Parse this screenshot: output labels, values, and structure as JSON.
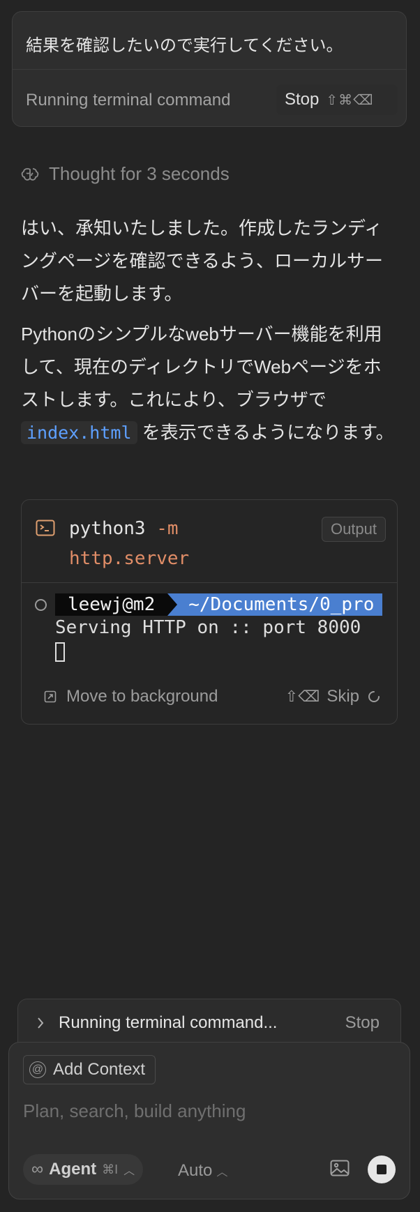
{
  "user_message": {
    "text": "結果を確認したいので実行してください。",
    "status": "Running terminal command",
    "stop_label": "Stop",
    "stop_shortcut": "⇧⌘⌫"
  },
  "thought": {
    "icon": "brain-icon",
    "label": "Thought for 3 seconds"
  },
  "assistant": {
    "p1": "はい、承知いたしました。作成したランディングページを確認できるよう、ローカルサーバーを起動します。",
    "p2_before": "Pythonのシンプルなwebサーバー機能を利用して、現在のディレクトリでWebページをホストします。これにより、ブラウザで",
    "p2_code": "index.html",
    "p2_after": "を表示できるようになります。"
  },
  "terminal": {
    "icon": "terminal-icon",
    "cmd_main": "python3",
    "cmd_flag": "-m",
    "cmd_arg": "http.server",
    "output_label": "Output",
    "prompt_user": "leewj@m2",
    "prompt_path": "~/Documents/0_pro",
    "output_line": "Serving HTTP on :: port 8000",
    "move_bg_label": "Move to background",
    "skip_shortcut": "⇧⌫",
    "skip_label": "Skip"
  },
  "run_bar": {
    "label": "Running terminal command...",
    "stop_label": "Stop"
  },
  "composer": {
    "add_context_label": "Add Context",
    "placeholder": "Plan, search, build anything",
    "mode_label": "Agent",
    "mode_shortcut": "⌘I",
    "model_label": "Auto"
  }
}
